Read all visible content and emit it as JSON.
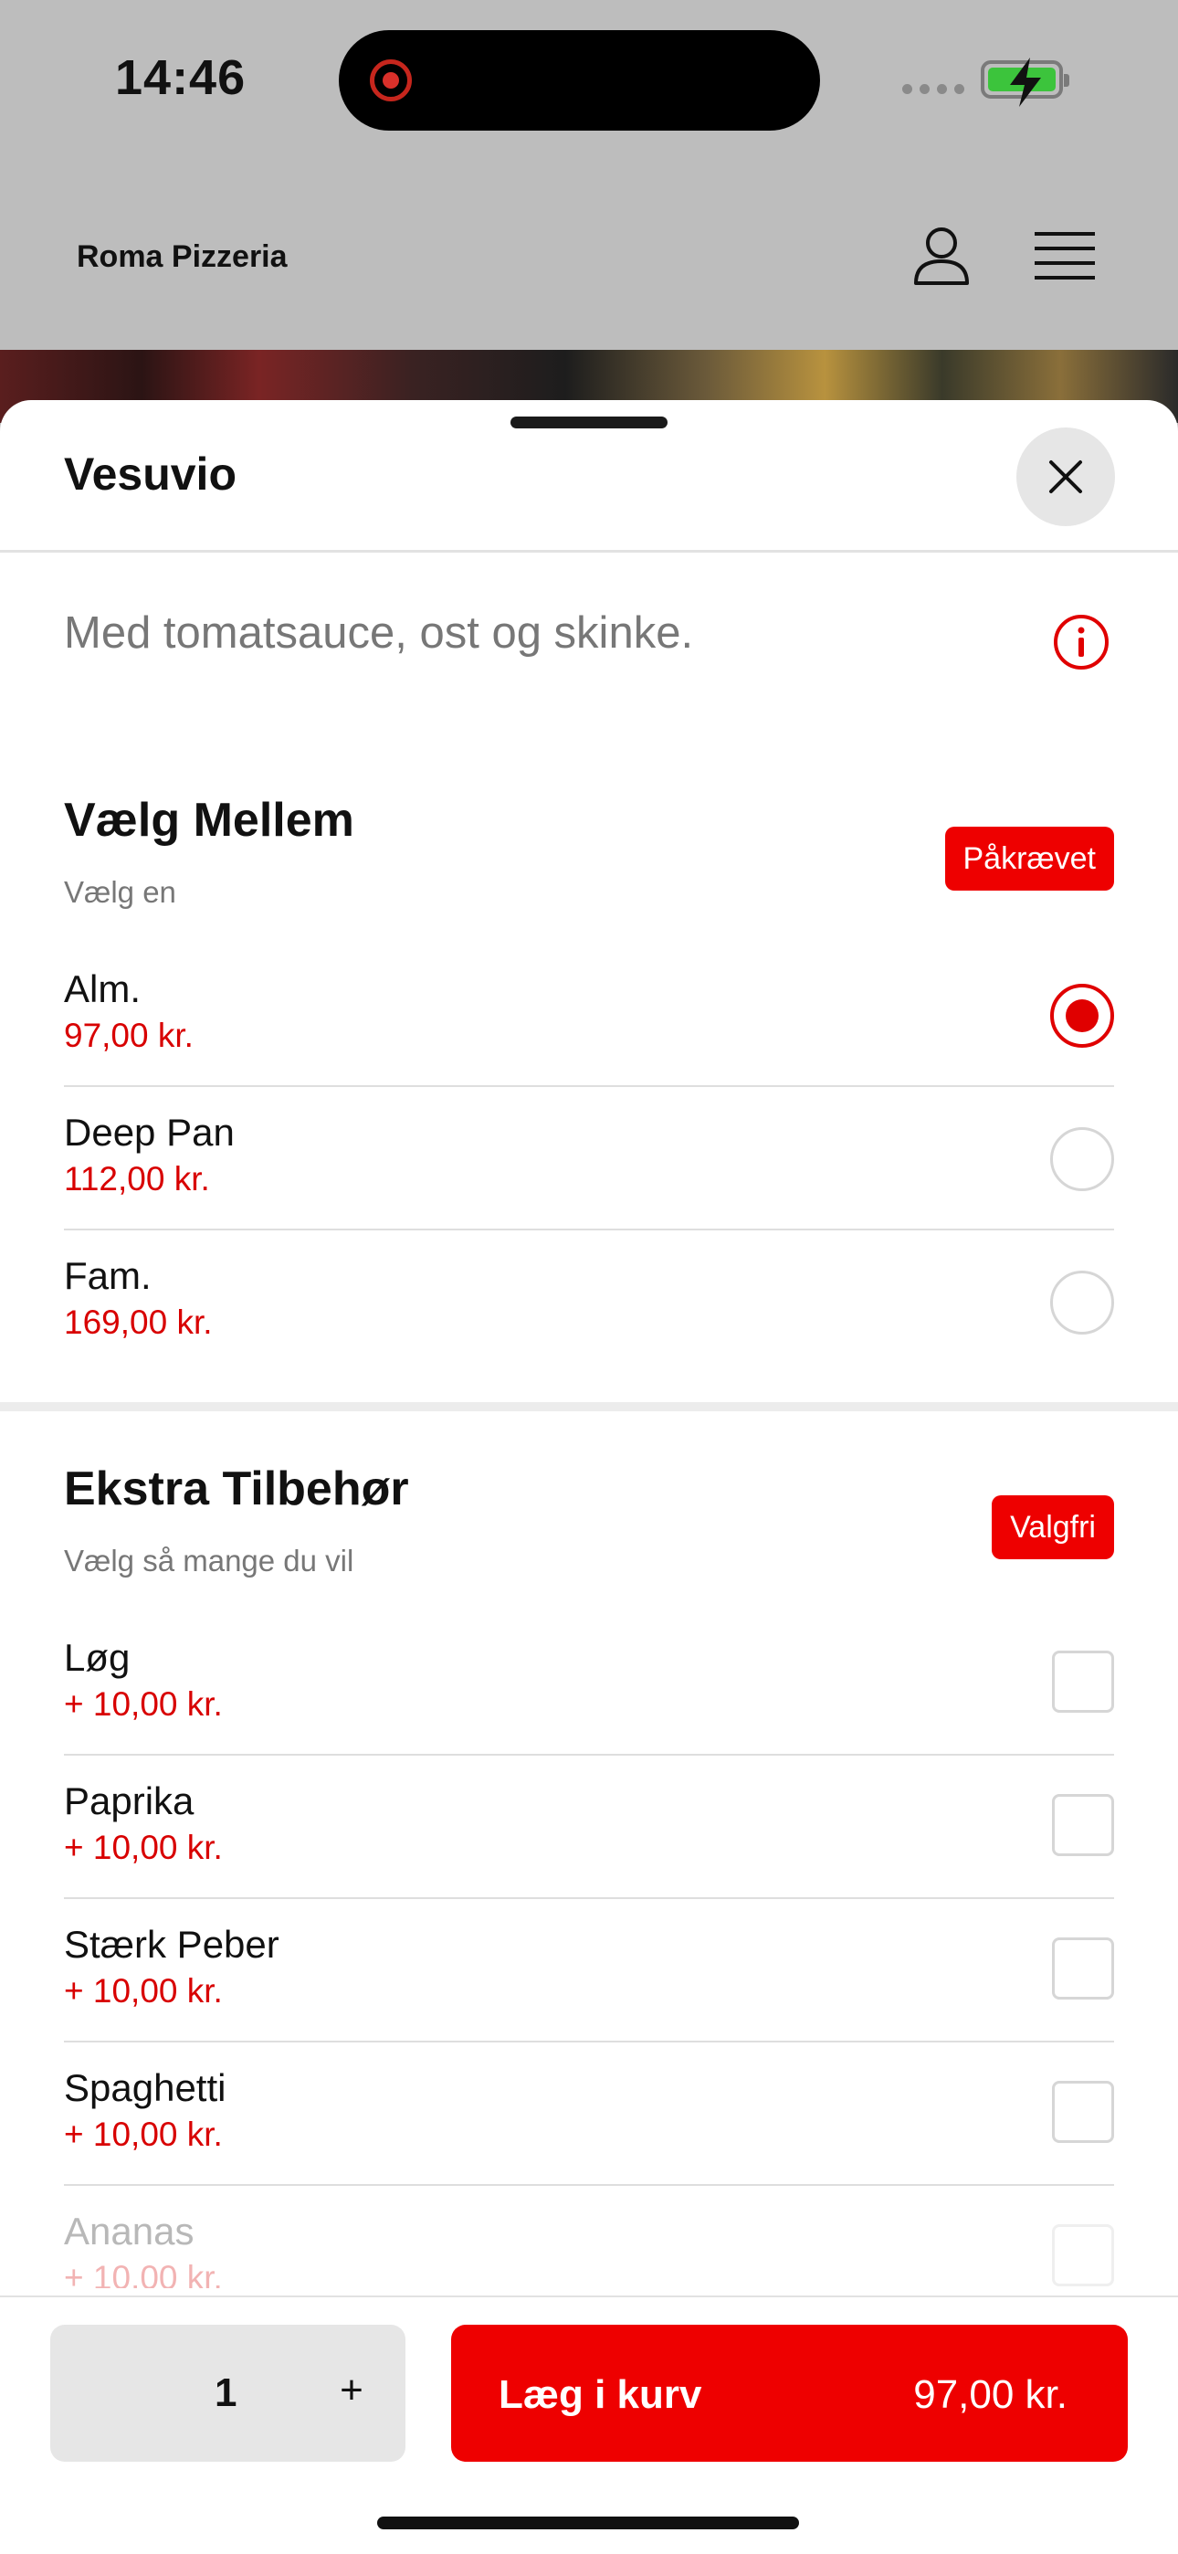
{
  "status_bar": {
    "time": "14:46"
  },
  "header": {
    "brand": "Roma Pizzeria",
    "icons": [
      "user-icon",
      "menu-icon"
    ]
  },
  "sheet": {
    "title": "Vesuvio",
    "description": "Med tomatsauce, ost og skinke.",
    "groups": [
      {
        "title": "Vælg Mellem",
        "subtitle": "Vælg en",
        "badge": "Påkrævet",
        "type": "radio",
        "options": [
          {
            "label": "Alm.",
            "price": "97,00 kr.",
            "selected": true
          },
          {
            "label": "Deep Pan",
            "price": "112,00 kr.",
            "selected": false
          },
          {
            "label": "Fam.",
            "price": "169,00 kr.",
            "selected": false
          }
        ]
      },
      {
        "title": "Ekstra Tilbehør",
        "subtitle": "Vælg så mange du vil",
        "badge": "Valgfri",
        "type": "checkbox",
        "options": [
          {
            "label": "Løg",
            "price": "+ 10,00 kr.",
            "checked": false
          },
          {
            "label": "Paprika",
            "price": "+ 10,00 kr.",
            "checked": false
          },
          {
            "label": "Stærk Peber",
            "price": "+ 10,00 kr.",
            "checked": false
          },
          {
            "label": "Spaghetti",
            "price": "+ 10,00 kr.",
            "checked": false
          },
          {
            "label": "Ananas",
            "price": "+ 10,00 kr.",
            "checked": false
          }
        ]
      }
    ]
  },
  "footer": {
    "quantity": "1",
    "plus_label": "+",
    "add_label": "Læg i kurv",
    "add_price": "97,00 kr."
  },
  "colors": {
    "accent": "#ee0000",
    "price": "#d80000",
    "overlay": "#bdbdbd"
  }
}
